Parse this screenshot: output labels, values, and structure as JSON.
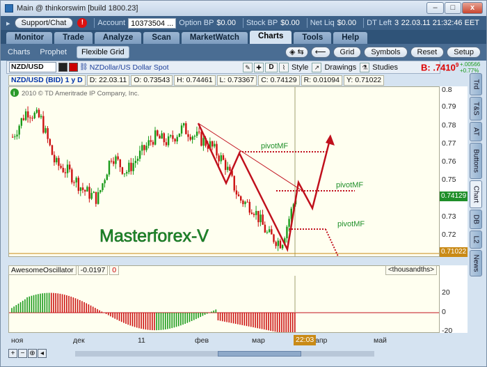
{
  "window": {
    "title": "Main @ thinkorswim [build 1800.23]",
    "min_label": "–",
    "max_label": "□",
    "close_label": "x"
  },
  "account_bar": {
    "support_label": "Support/Chat",
    "alert_glyph": "!",
    "account_label": "Account",
    "account_value": "10373504 ...",
    "option_bp_label": "Option BP",
    "option_bp_value": "$0.00",
    "stock_bp_label": "Stock BP",
    "stock_bp_value": "$0.00",
    "net_liq_label": "Net Liq",
    "net_liq_value": "$0.00",
    "dt_left_label": "DT Left",
    "dt_left_value": "3",
    "datetime": "22.03.11 21:32:46 EET"
  },
  "tabs": [
    "Monitor",
    "Trade",
    "Analyze",
    "Scan",
    "MarketWatch",
    "Charts",
    "Tools",
    "Help"
  ],
  "active_tab": "Charts",
  "subtabs": [
    "Charts",
    "Prophet",
    "Flexible Grid"
  ],
  "subbar_buttons": [
    "Grid",
    "Symbols",
    "Reset",
    "Setup"
  ],
  "symbol_bar": {
    "symbol": "NZD/USD",
    "description": "NZDollar/US Dollar Spot",
    "period_btn": "D",
    "style_label": "Style",
    "drawings_label": "Drawings",
    "studies_label": "Studies",
    "bid_label": "B: .7410",
    "bid_sup": "9",
    "change_abs": "+.00566",
    "change_pct": "+0.77%"
  },
  "info_bar": {
    "instrument": "NZD/USD (BID) 1 y D",
    "date": "D: 22.03.11",
    "open": "O: 0.73543",
    "high": "H: 0.74461",
    "low": "L: 0.73367",
    "close": "C: 0.74129",
    "range": "R: 0.01094",
    "y": "Y: 0.71022"
  },
  "copyright": "2010 © TD Ameritrade IP Company, Inc.",
  "watermark": "Masterforex-V",
  "pivot_labels": [
    "pivotMF",
    "pivotMF",
    "pivotMF"
  ],
  "price_axis": {
    "ticks": [
      "0.8",
      "0.79",
      "0.78",
      "0.77",
      "0.76",
      "0.75",
      "0.73",
      "0.72"
    ],
    "current_label": "0.74129",
    "current_color": "#1f8f2a",
    "y_label": "0.71022",
    "y_color": "#c98a16"
  },
  "oscillator": {
    "name": "AwesomeOscillator",
    "value": "-0.0197",
    "zero": "0",
    "units": "<thousandths>",
    "ticks": [
      "20",
      "0",
      "-20"
    ]
  },
  "date_axis": {
    "ticks": [
      "ноя",
      "дек",
      "11",
      "фев",
      "мар",
      "апр",
      "май"
    ],
    "cursor_time": "22:03"
  },
  "vertical_tabs": [
    "Trd",
    "T&S",
    "AT",
    "Buttons",
    "Chart",
    "DB",
    "L2",
    "News"
  ],
  "active_vertical_tab": "Chart",
  "colors": {
    "up_candle": "#1a9a1a",
    "down_candle": "#cc1111",
    "chart_bg": "#fffff0",
    "annotation": "#c0101c"
  },
  "chart_data": {
    "type": "candlestick",
    "title": "NZD/USD (BID) 1 y D",
    "x_range": [
      "ноя",
      "май"
    ],
    "ylim": [
      0.71,
      0.8
    ],
    "approx_close_path": [
      0.775,
      0.79,
      0.785,
      0.76,
      0.755,
      0.745,
      0.74,
      0.765,
      0.755,
      0.765,
      0.775,
      0.772,
      0.78,
      0.775,
      0.77,
      0.76,
      0.74,
      0.735,
      0.72,
      0.715,
      0.7413
    ],
    "oscillator_range": [
      -20,
      20
    ]
  }
}
